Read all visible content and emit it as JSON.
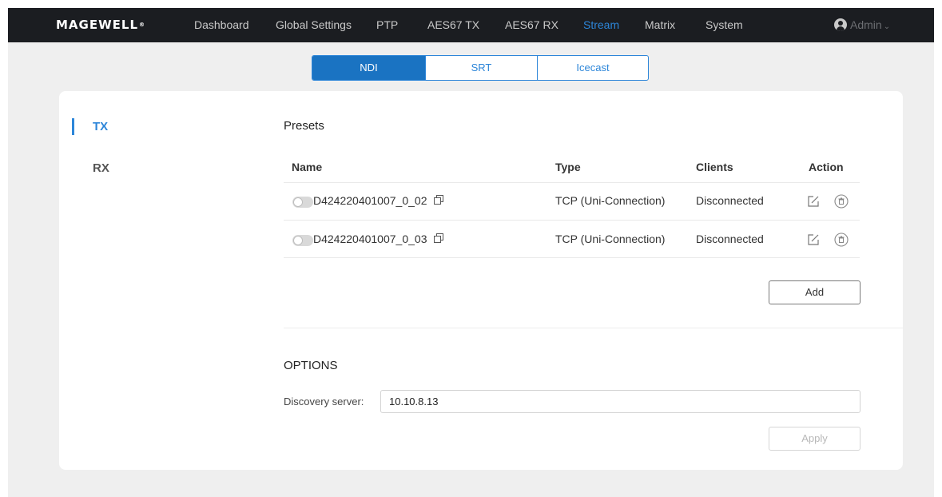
{
  "brand": {
    "logo_text": "MAGEWELL",
    "reg_mark": "®"
  },
  "nav": {
    "items": [
      {
        "label": "Dashboard",
        "active": false
      },
      {
        "label": "Global Settings",
        "active": false
      },
      {
        "label": "PTP",
        "active": false
      },
      {
        "label": "AES67 TX",
        "active": false
      },
      {
        "label": "AES67 RX",
        "active": false
      },
      {
        "label": "Stream",
        "active": true
      },
      {
        "label": "Matrix",
        "active": false
      },
      {
        "label": "System",
        "active": false
      }
    ],
    "user_label": "Admin",
    "user_icon": "user-avatar-icon",
    "user_chevron_icon": "chevron-down-icon"
  },
  "protocol_tabs": [
    {
      "label": "NDI",
      "active": true
    },
    {
      "label": "SRT",
      "active": false
    },
    {
      "label": "Icecast",
      "active": false
    }
  ],
  "side_nav": [
    {
      "label": "TX",
      "active": true
    },
    {
      "label": "RX",
      "active": false
    }
  ],
  "presets": {
    "title": "Presets",
    "columns": [
      "Name",
      "Type",
      "Clients",
      "Action"
    ],
    "rows": [
      {
        "name": "D424220401007_0_02",
        "type": "TCP (Uni-Connection)",
        "clients": "Disconnected",
        "enabled": false
      },
      {
        "name": "D424220401007_0_03",
        "type": "TCP (Uni-Connection)",
        "clients": "Disconnected",
        "enabled": false
      }
    ],
    "add_label": "Add",
    "icons": {
      "copy": "copy-icon",
      "edit": "edit-icon",
      "delete": "delete-icon"
    }
  },
  "options": {
    "title": "OPTIONS",
    "discovery_label": "Discovery server:",
    "discovery_value": "10.10.8.13",
    "apply_label": "Apply"
  },
  "colors": {
    "accent": "#2d86d9",
    "active_tab_bg": "#1a73c2",
    "topbar_bg": "#1b1d21",
    "page_bg": "#efefef"
  }
}
